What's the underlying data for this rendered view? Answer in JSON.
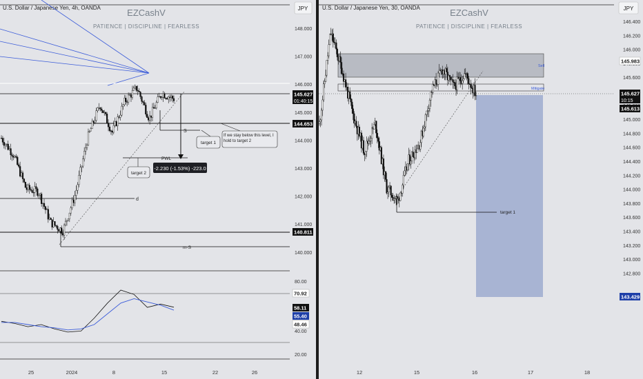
{
  "left_panel": {
    "symbol_title": "U.S. Dollar / Japanese Yen, 4h, OANDA",
    "currency_button": "JPY",
    "watermark_title": "EZCashV",
    "watermark_subtitle": "PATIENCE  |  DISCIPLINE  |  FEARLESS",
    "price_axis_ticks": [
      "148.000",
      "147.000",
      "146.000",
      "145.000",
      "144.000",
      "143.000",
      "142.000",
      "141.000",
      "140.000"
    ],
    "price_badges": [
      {
        "label": "145.627",
        "sub": "01:40:15",
        "color": "#111111"
      },
      {
        "label": "144.653",
        "sub": "",
        "color": "#111111"
      },
      {
        "label": "140.811",
        "sub": "",
        "color": "#111111"
      }
    ],
    "rsi_ticks": [
      "80.00",
      "40.00",
      "20.00"
    ],
    "rsi_badges": [
      {
        "label": "70.92",
        "color": "#ffffff"
      },
      {
        "label": "58.11",
        "color": "#111111"
      },
      {
        "label": "55.40",
        "color": "#1e3fa8"
      },
      {
        "label": "48.46",
        "color": "#ffffff"
      }
    ],
    "time_ticks": [
      "25",
      "2024",
      "8",
      "15",
      "22",
      "26"
    ],
    "annotations": {
      "s_label": "S",
      "target1": "target 1",
      "target2": "target 2",
      "pwl": "PWL",
      "d_label": "d",
      "ms_label": "m-S",
      "note": "If we stay below this level, I hold to target 2",
      "measure": "-2.230 (-1.53%) -223.0"
    }
  },
  "right_panel": {
    "symbol_title": "U.S. Dollar / Japanese Yen, 30, OANDA",
    "currency_button": "JPY",
    "watermark_title": "EZCashV",
    "watermark_subtitle": "PATIENCE  |  DISCIPLINE  |  FEARLESS",
    "price_axis_ticks": [
      "146.400",
      "146.200",
      "146.000",
      "145.800",
      "145.600",
      "145.400",
      "145.200",
      "145.000",
      "144.800",
      "144.600",
      "144.400",
      "144.200",
      "144.000",
      "143.800",
      "143.600",
      "143.400",
      "143.200",
      "143.000",
      "142.800"
    ],
    "price_badges": [
      {
        "label": "145.983",
        "sub": "",
        "color": "#ffffff"
      },
      {
        "label": "145.627",
        "sub": "10:15",
        "color": "#111111"
      },
      {
        "label": "145.613",
        "sub": "",
        "color": "#111111"
      },
      {
        "label": "143.429",
        "sub": "",
        "color": "#1e3fa8"
      }
    ],
    "time_ticks": [
      "12",
      "15",
      "16",
      "17",
      "18"
    ],
    "annotations": {
      "sell": "Sell",
      "mitigate": "Mitigate",
      "target1": "target 1"
    }
  },
  "chart_data": [
    {
      "type": "candlestick",
      "title": "U.S. Dollar / Japanese Yen, 4h, OANDA",
      "ylim": [
        139.6,
        148.6
      ],
      "grid": false,
      "x": [
        "25",
        "2024",
        "8",
        "15",
        "22",
        "26"
      ],
      "close_path": [
        {
          "x": "Dec 18",
          "y": 144.2
        },
        {
          "x": "Dec 20",
          "y": 143.6
        },
        {
          "x": "Dec 22",
          "y": 142.4
        },
        {
          "x": "Dec 26",
          "y": 142.3
        },
        {
          "x": "Dec 28",
          "y": 141.2
        },
        {
          "x": "Dec 29",
          "y": 140.9
        },
        {
          "x": "Jan 2",
          "y": 142.2
        },
        {
          "x": "Jan 4",
          "y": 144.2
        },
        {
          "x": "Jan 5",
          "y": 145.4
        },
        {
          "x": "Jan 8",
          "y": 144.4
        },
        {
          "x": "Jan 10",
          "y": 145.5
        },
        {
          "x": "Jan 11",
          "y": 146.0
        },
        {
          "x": "Jan 12",
          "y": 144.9
        },
        {
          "x": "Jan 15",
          "y": 145.8
        },
        {
          "x": "Jan 16",
          "y": 145.6
        }
      ],
      "levels": [
        145.627,
        144.653,
        140.811
      ]
    },
    {
      "type": "line",
      "title": "RSI",
      "ylim": [
        10,
        90
      ],
      "series": [
        {
          "values": [
            45,
            43,
            40,
            42,
            38,
            35,
            36,
            48,
            62,
            74,
            70,
            58,
            61,
            58.11
          ]
        },
        {
          "values": [
            44,
            44,
            42,
            40,
            39,
            37,
            38,
            42,
            52,
            62,
            66,
            63,
            60,
            55.4
          ]
        }
      ],
      "levels": [
        70.92,
        48.46
      ]
    },
    {
      "type": "candlestick",
      "title": "U.S. Dollar / Japanese Yen, 30, OANDA",
      "ylim": [
        142.75,
        146.55
      ],
      "grid": false,
      "x": [
        "12",
        "15",
        "16",
        "17",
        "18"
      ],
      "close_path": [
        {
          "x": "start",
          "y": 145.3
        },
        {
          "x": "spike",
          "y": 146.3
        },
        {
          "x": "a",
          "y": 145.9
        },
        {
          "x": "b",
          "y": 145.4
        },
        {
          "x": "c",
          "y": 145.0
        },
        {
          "x": "d",
          "y": 145.3
        },
        {
          "x": "e",
          "y": 144.6
        },
        {
          "x": "low",
          "y": 144.45
        },
        {
          "x": "f",
          "y": 144.9
        },
        {
          "x": "g",
          "y": 145.1
        },
        {
          "x": "h",
          "y": 145.65
        },
        {
          "x": "i",
          "y": 145.9
        },
        {
          "x": "j",
          "y": 145.7
        },
        {
          "x": "k",
          "y": 145.85
        },
        {
          "x": "last",
          "y": 145.627
        }
      ],
      "zones": [
        {
          "name": "Sell",
          "from": 145.8,
          "to": 145.98
        },
        {
          "name": "Mitigate",
          "from": 145.65,
          "to": 145.72
        },
        {
          "name": "target",
          "from": 143.429,
          "to": 145.627
        }
      ]
    }
  ]
}
